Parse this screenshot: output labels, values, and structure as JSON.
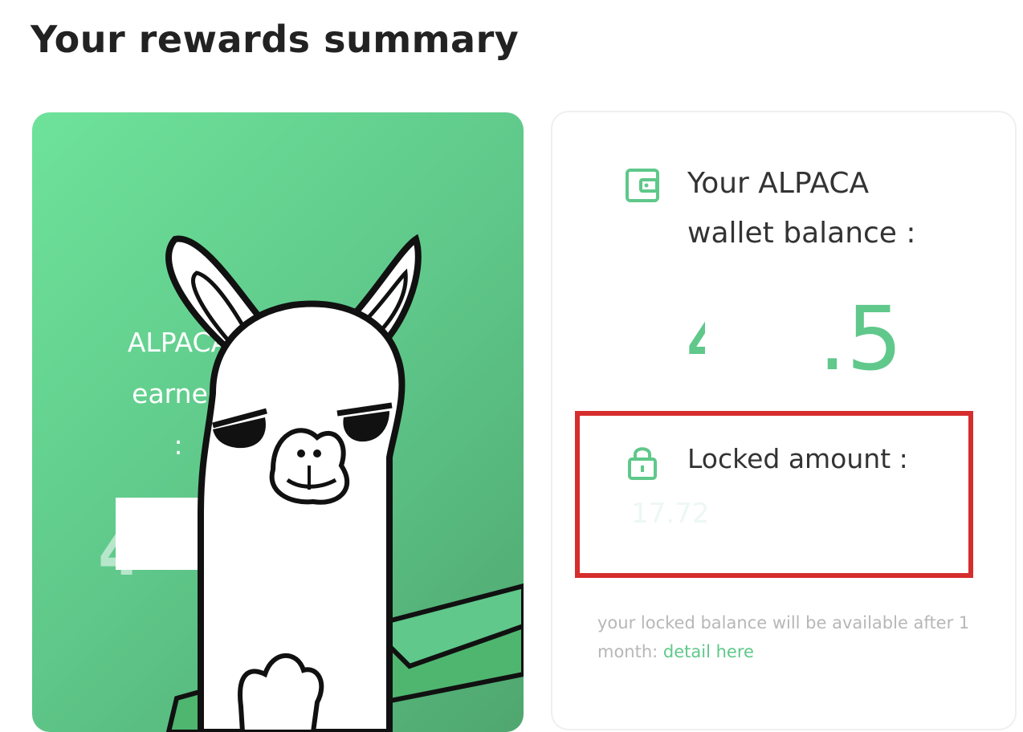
{
  "page": {
    "title": "Your rewards summary"
  },
  "reward_card": {
    "label_line1": "ALPACA",
    "label_line2": "earned",
    "label_line3": ":",
    "value": "4",
    "gradient_colors": [
      "#6ee29a",
      "#4fa76f"
    ]
  },
  "balance_card": {
    "wallet_icon": "wallet-icon",
    "wallet_label_line1": "Your ALPACA",
    "wallet_label_line2": "wallet balance :",
    "wallet_value_visible": "4",
    "wallet_value_suffix": ".5",
    "lock_icon": "lock-icon",
    "locked_label": "Locked amount :",
    "locked_value": "17.72",
    "note_text": "your locked balance will be available after 1 month:",
    "detail_link": "detail here"
  },
  "colors": {
    "accent": "#5fc88a",
    "highlight_border": "#d62d2d",
    "text_dark": "#222222",
    "text_muted": "#b7b7b7"
  }
}
